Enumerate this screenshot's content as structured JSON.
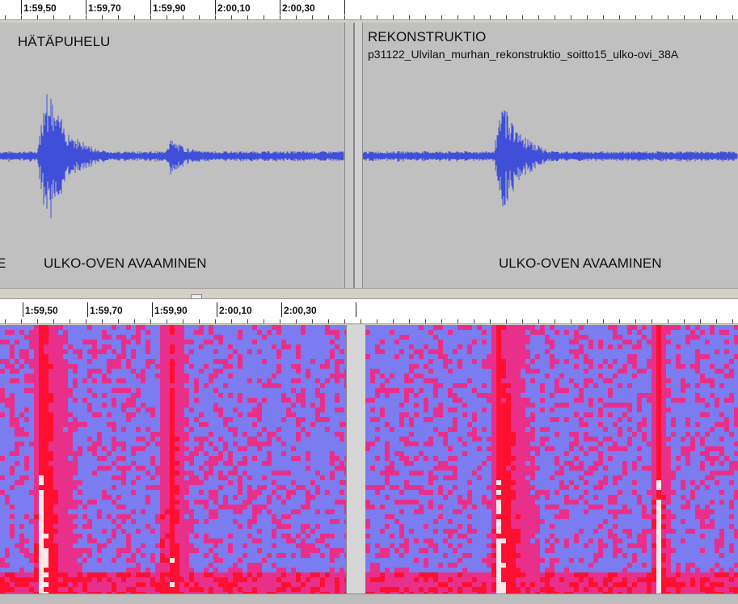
{
  "top_ruler": {
    "labels": [
      "1:59,50",
      "1:59,70",
      "1:59,90",
      "2:00,10",
      "2:00,30"
    ]
  },
  "bottom_ruler": {
    "labels": [
      "1:59,50",
      "1:59,70",
      "1:59,90",
      "2:00,10",
      "2:00,30"
    ]
  },
  "left_track": {
    "title": "HÄTÄPUHELU",
    "left_edge_caption": "E",
    "caption": "ULKO-OVEN AVAAMINEN"
  },
  "right_track": {
    "title": "REKONSTRUKTIO",
    "filename": "p31122_Ulvilan_murhan_rekonstruktio_soitto15_ulko-ovi_38A",
    "caption": "ULKO-OVEN AVAAMINEN"
  },
  "colors": {
    "waveform": "#3f4fd8",
    "wave_background": "#c0c0c0",
    "spectrogram_low": "#7a7cf0",
    "spectrogram_mid": "#e8308a",
    "spectrogram_high": "#ff1030",
    "spectrogram_peak": "#ffe8e8"
  }
}
